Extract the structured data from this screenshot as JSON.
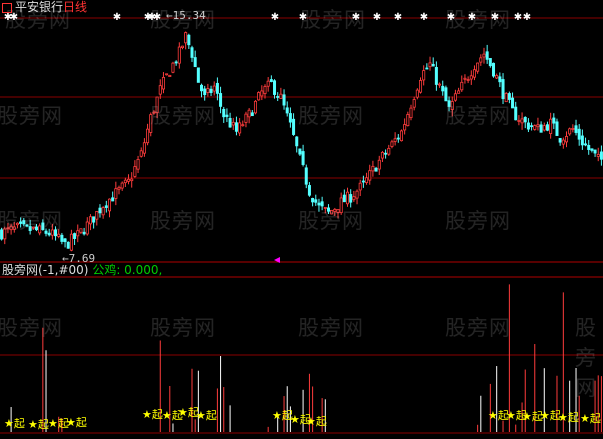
{
  "header": {
    "stock_name": "平安银行",
    "period": "日线"
  },
  "indicator": {
    "name": "股旁网",
    "params": "(-1,#00)",
    "series_label": "公鸡: 0.000,"
  },
  "annotations": {
    "high_label": "15.34",
    "low_label": "7.69",
    "signal_text": "起"
  },
  "watermark": "股旁网",
  "colors": {
    "background": "#000000",
    "up_candle": "#ff3c3c",
    "down_candle": "#54ffff",
    "grid": "#8a0000",
    "signal": "#ffff00",
    "marker": "#ff00ff"
  },
  "chart_data": [
    {
      "type": "candlestick",
      "title": "平安银行 日线",
      "ylim": [
        7.3,
        16.0
      ],
      "grid": true,
      "high": 15.34,
      "low": 7.69,
      "close_path": [
        {
          "x": 0,
          "y": 8.2
        },
        {
          "x": 5,
          "y": 8.35
        },
        {
          "x": 10,
          "y": 8.3
        },
        {
          "x": 15,
          "y": 8.2
        },
        {
          "x": 18,
          "y": 7.95
        },
        {
          "x": 20,
          "y": 7.75
        },
        {
          "x": 24,
          "y": 8.1
        },
        {
          "x": 28,
          "y": 8.6
        },
        {
          "x": 32,
          "y": 9.2
        },
        {
          "x": 36,
          "y": 9.6
        },
        {
          "x": 40,
          "y": 10.0
        },
        {
          "x": 44,
          "y": 11.0
        },
        {
          "x": 47,
          "y": 12.3
        },
        {
          "x": 50,
          "y": 13.3
        },
        {
          "x": 53,
          "y": 14.0
        },
        {
          "x": 56,
          "y": 14.6
        },
        {
          "x": 58,
          "y": 15.2
        },
        {
          "x": 60,
          "y": 14.6
        },
        {
          "x": 62,
          "y": 13.6
        },
        {
          "x": 64,
          "y": 13.0
        },
        {
          "x": 67,
          "y": 13.4
        },
        {
          "x": 70,
          "y": 12.4
        },
        {
          "x": 74,
          "y": 11.8
        },
        {
          "x": 78,
          "y": 12.4
        },
        {
          "x": 82,
          "y": 13.2
        },
        {
          "x": 85,
          "y": 13.5
        },
        {
          "x": 88,
          "y": 13.0
        },
        {
          "x": 91,
          "y": 12.0
        },
        {
          "x": 94,
          "y": 10.8
        },
        {
          "x": 97,
          "y": 9.7
        },
        {
          "x": 100,
          "y": 9.1
        },
        {
          "x": 103,
          "y": 8.9
        },
        {
          "x": 106,
          "y": 9.2
        },
        {
          "x": 110,
          "y": 9.5
        },
        {
          "x": 114,
          "y": 9.9
        },
        {
          "x": 118,
          "y": 10.6
        },
        {
          "x": 122,
          "y": 11.2
        },
        {
          "x": 126,
          "y": 11.8
        },
        {
          "x": 129,
          "y": 12.8
        },
        {
          "x": 132,
          "y": 13.8
        },
        {
          "x": 135,
          "y": 14.2
        },
        {
          "x": 138,
          "y": 13.4
        },
        {
          "x": 141,
          "y": 12.6
        },
        {
          "x": 145,
          "y": 13.4
        },
        {
          "x": 149,
          "y": 14.2
        },
        {
          "x": 152,
          "y": 14.6
        },
        {
          "x": 155,
          "y": 14.0
        },
        {
          "x": 158,
          "y": 13.2
        },
        {
          "x": 161,
          "y": 12.5
        },
        {
          "x": 165,
          "y": 12.1
        },
        {
          "x": 169,
          "y": 11.9
        },
        {
          "x": 173,
          "y": 12.1
        },
        {
          "x": 176,
          "y": 11.6
        },
        {
          "x": 180,
          "y": 11.9
        },
        {
          "x": 184,
          "y": 11.3
        },
        {
          "x": 188,
          "y": 10.8
        }
      ]
    },
    {
      "type": "bar",
      "title": "股旁网(-1,#00)",
      "series": [
        {
          "name": "公鸡",
          "values": [
            0.0
          ]
        }
      ],
      "grid": true
    }
  ]
}
